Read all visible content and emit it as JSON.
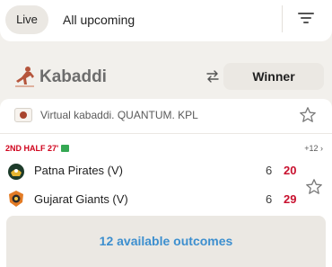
{
  "tabs": {
    "live_label": "Live",
    "upcoming_label": "All upcoming"
  },
  "filter": {
    "icon": "filter-lines-icon"
  },
  "sport": {
    "title": "Kabaddi",
    "icon": "kabaddi-player-icon",
    "swap_icon": "swap-arrows-icon",
    "market_label": "Winner"
  },
  "league": {
    "name": "Virtual kabaddi. QUANTUM. KPL",
    "icon": "virtual-league-icon",
    "favourite_icon": "star-outline-icon"
  },
  "event": {
    "status": "2ND HALF 27'",
    "status_icon": "live-stats-icon",
    "more_markets": "+12 ›",
    "teams": [
      {
        "name": "Patna Pirates (V)",
        "period_score": "6",
        "total_score": "20",
        "logo": "patna-pirates-logo"
      },
      {
        "name": "Gujarat Giants (V)",
        "period_score": "6",
        "total_score": "29",
        "logo": "gujarat-giants-logo"
      }
    ],
    "favourite_icon": "star-outline-icon",
    "outcomes_label": "12 available outcomes"
  },
  "colors": {
    "background": "#f2f0ec",
    "live_red": "#d0021b",
    "score_red": "#c8102e",
    "link_blue": "#3d8fcf",
    "pill": "#ebe8e3"
  }
}
